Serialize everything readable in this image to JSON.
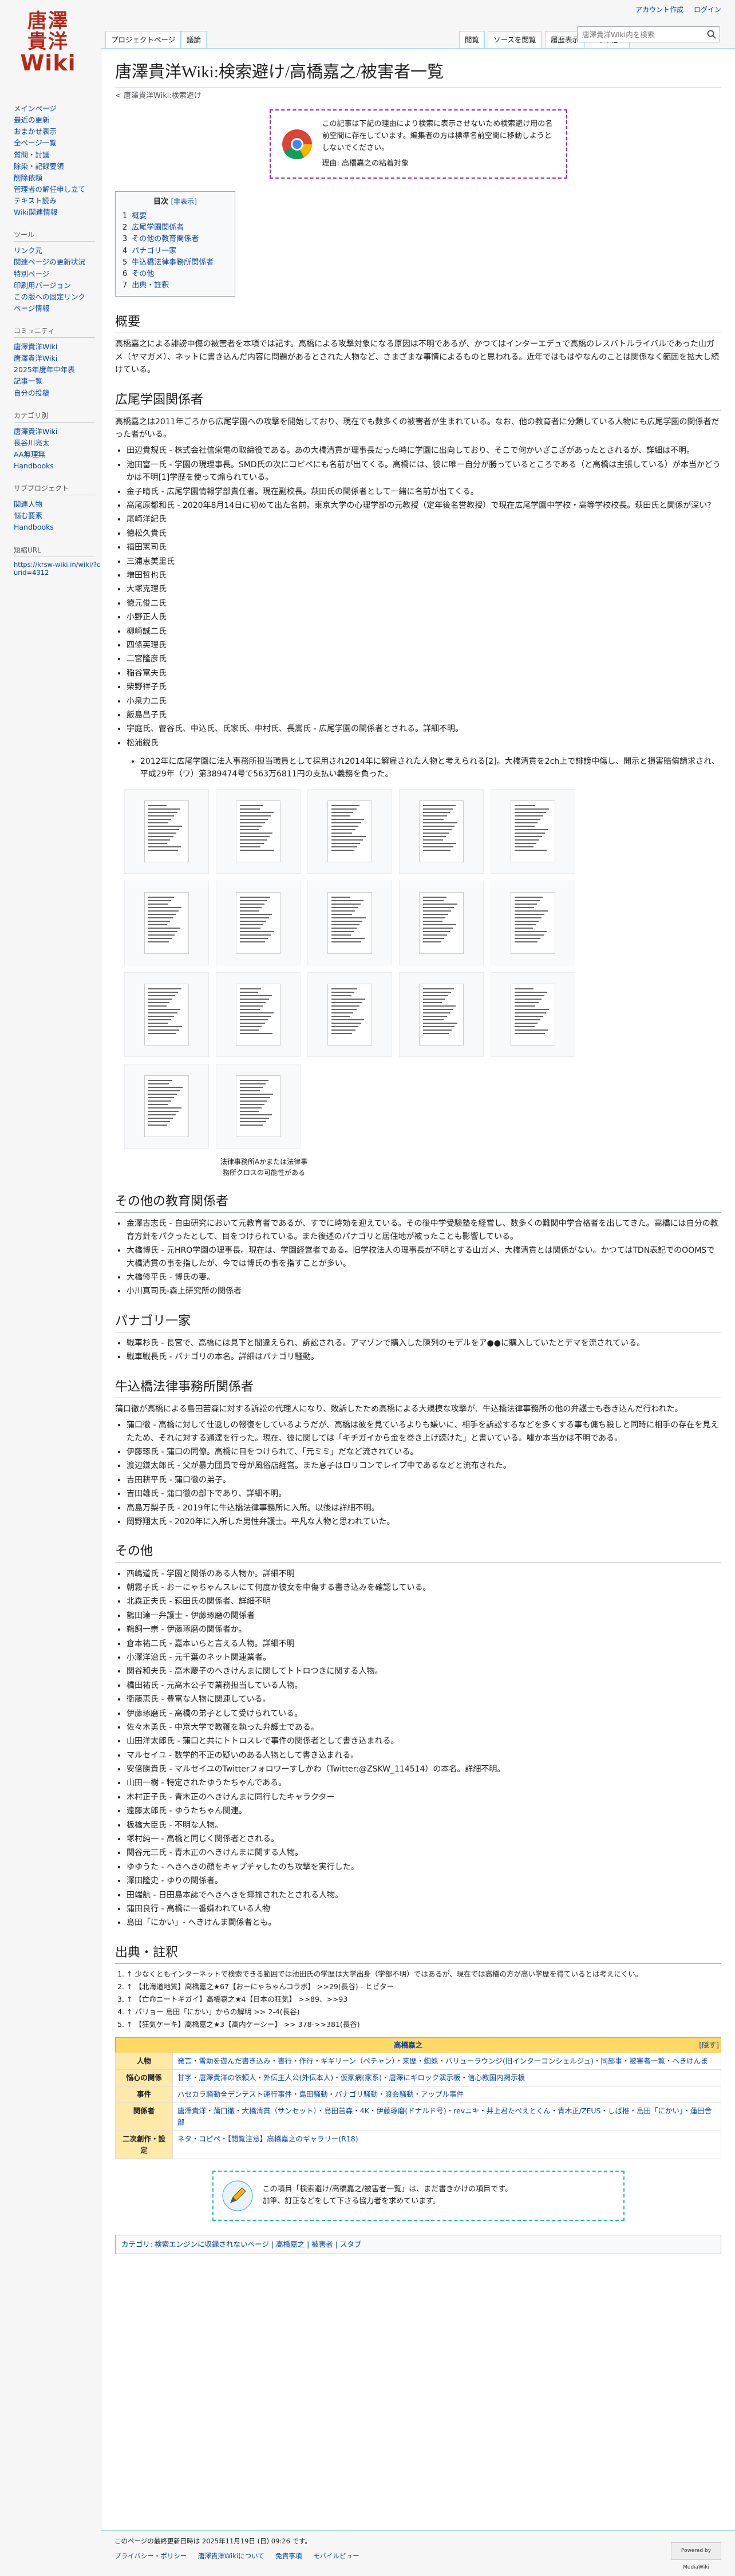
{
  "logo": {
    "line1": "唐澤",
    "line2": "貴洋",
    "line3": "Wiki"
  },
  "personal": {
    "create": "アカウント作成",
    "login": "ログイン"
  },
  "tabs": {
    "project": "プロジェクトページ",
    "talk": "議論",
    "read": "閲覧",
    "edit_source": "ソースを閲覧",
    "history": "履歴表示",
    "more": "その他"
  },
  "search": {
    "placeholder": "唐澤貴洋Wiki内を検索"
  },
  "sidebar": {
    "nav": [
      "メインページ",
      "最近の更新",
      "おまかせ表示",
      "全ページ一覧",
      "質問・討議",
      "除染・記録要領",
      "削除依頼",
      "管理者の解任申し立て",
      "テキスト読み",
      "Wiki関連情報"
    ],
    "tools_h": "ツール",
    "tools": [
      "リンク元",
      "関連ページの更新状況",
      "特別ページ",
      "印刷用バージョン",
      "この版への固定リンク",
      "ページ情報"
    ],
    "links_h": "コミュニティ",
    "links": [
      "唐澤貴洋Wiki",
      "唐澤貴洋Wiki",
      "2025年度年中年表",
      "記事一覧",
      "自分の投稿"
    ],
    "cat_h": "カテゴリ別",
    "cats": [
      "唐澤貴洋Wiki",
      "長谷川亮太",
      "AA無理無",
      "Handbooks"
    ],
    "sub_h": "サブプロジェクト",
    "subs": [
      "関連人物",
      "悩む要素",
      "Handbooks"
    ],
    "short_h": "短縮URL",
    "short": "https://krsw-wiki.in/wiki/?curid=4312"
  },
  "page": {
    "title": "唐澤貴洋Wiki:検索避け/高橋嘉之/被害者一覧",
    "subtitle": "< 唐澤貴洋Wiki:検索避け",
    "notice_line1": "この記事は下記の理由により検索に表示させないため検索避け用の名前空間に存在しています。編集者の方は標準名前空間に移動しようとしないでください。",
    "notice_reason": "理由: 高橋嘉之の粘着対象"
  },
  "toc": {
    "title": "目次",
    "hide": "[非表示]",
    "items": [
      {
        "n": "1",
        "t": "概要"
      },
      {
        "n": "2",
        "t": "広尾学園関係者"
      },
      {
        "n": "3",
        "t": "その他の教育関係者"
      },
      {
        "n": "4",
        "t": "パナゴリ一家"
      },
      {
        "n": "5",
        "t": "牛込橋法律事務所関係者"
      },
      {
        "n": "6",
        "t": "その他"
      },
      {
        "n": "7",
        "t": "出典・註釈"
      }
    ]
  },
  "sections": {
    "s1": "概要",
    "s1p": "高橋嘉之による誹謗中傷の被害者を本項では記す。高橋による攻撃対象になる原因は不明であるが、かつてはインターエデュで高橋のレスバトルライバルであった山ガメ（ヤマガメ）、ネットに書き込んだ内容に問題があるとされた人物など、さまざまな事情によるものと思われる。近年ではもはやなんのことは関係なく範囲を拡大し続けている。",
    "s2": "広尾学園関係者",
    "s2p": "高橋嘉之は2011年ごろから広尾学園への攻撃を開始しており、現在でも数多くの被害者が生まれている。なお、他の教育者に分類している人物にも広尾学園の関係者だった者がいる。",
    "s2items": [
      "田辺貴規氏 - 株式会社信栄電の取締役である。あの大橋清貫が理事長だった時に学園に出向しており、そこで何かいざこざがあったとされるが、詳細は不明。",
      "池田富一氏 - 学園の現理事長。SMD氏の次にコピペにも名前が出てくる。高橋には、彼に唯一自分が勝っているところである（と高橋は主張している）が本当かどうかは不明[1]学歴を使って煽られている。",
      "金子晴氏 - 広尾学園情報学部責任者。現在副校長。萩田氏の関係者として一緒に名前が出てくる。",
      "高尾原都和氏 - 2020年8月14日に初めて出た名前。東京大学の心理学部の元教授（定年後名誉教授）で現在広尾学園中学校・高等学校校長。萩田氏と関係が深い?",
      "尾崎洋紀氏",
      "徳松久貴氏",
      "福田憲司氏",
      "三浦恵美里氏",
      "増田哲也氏",
      "大塚克理氏",
      "徳元俊二氏",
      "小野正人氏",
      "柳崎誠二氏",
      "四條英理氏",
      "二宮隆彦氏",
      "稲谷富夫氏",
      "柴野祥子氏",
      "小泉力二氏",
      "飯島昌子氏",
      "宇庭氏、菅谷氏、中込氏、氏家氏、中村氏、長嵩氏 - 広尾学園の関係者とされる。詳細不明。",
      "松浦鋭氏"
    ],
    "s2sub": "2012年に広尾学園に法人事務所担当職員として採用され2014年に解雇された人物と考えられる[2]。大橋清貫を2ch上で誹謗中傷し、開示と損害賠償請求され、平成29年（ワ）第389474号で563万6811円の支払い義務を負った。",
    "gallery_cap": "法律事務所Aかまたは法律事務所クロスの可能性がある",
    "s3": "その他の教育関係者",
    "s3items": [
      "金澤古志氏 - 自由研究において元教育者であるが、すでに時効を迎えている。その後中学受験塾を経営し、数多くの難関中学合格者を出してきた。高橋には自分の教育方針をパクったとして、目をつけられている。また後述のパナゴリと居住地が被ったことも影響している。",
      "大橋博氏 - 元HRO学園の理事長。現在は、学園経営者である。旧学校法人の理事長が不明とする山ガメ、大橋清貫とは関係がない。かつてはTDN表記でのOOMSで大橋清貫の事を指したが、今では博氏の事を指すことが多い。",
      "大橋修平氏 - 博氏の妻。",
      "小川真司氏-森上研究所の関係者"
    ],
    "s4": "パナゴリ一家",
    "s4items": [
      "戦車杉氏 - 長宮で、高橋には見下と間違えられ、訴訟される。アマゾンで購入した陳列のモデルをア●●に購入していたとデマを流されている。",
      "戦車戦長氏 - パナゴリの本名。詳細はパナゴリ騒動。"
    ],
    "s5": "牛込橋法律事務所関係者",
    "s5p": "蒲口徹が高橋による島田苦森に対する訴訟の代理人になり、敗訴したため高橋による大規模な攻撃が、牛込橋法律事務所の他の弁護士も巻き込んだ行われた。",
    "s5items": [
      "蒲口徹 - 高橋に対して仕返しの報復をしているようだが、高橋は彼を見ているよりも嫌いに、相手を訴訟するなどを多くする事も傭ち殺しと同時に相手の存在を見えたため、それに対する通達を行った。現在、彼に関しては「キチガイから金を巻き上げ続けた」と書いている。嘘か本当かは不明である。",
      "伊藤琢氏 - 蒲口の同僚。高橋に目をつけられて、「元ミミ」だなど流されている。",
      "渡辺鎌太郎氏 - 父が暴力団員で母が風俗店経営。また息子はロリコンでレイプ中であるなどと流布された。",
      "吉田耕平氏 - 蒲口徹の弟子。",
      "吉田雄氏 - 蒲口徹の部下であり、詳細不明。",
      "高島万梨子氏 - 2019年に牛込橋法律事務所に入所。以後は詳細不明。",
      "岡野翔太氏 - 2020年に入所した男性弁護士。平凡な人物と思われていた。"
    ],
    "s6": "その他",
    "s6items": [
      "西嶋道氏 - 学園と関係のある人物か。詳細不明",
      "朝霧子氏 - おーにゃちゃんスレにて何度か彼女を中傷する書き込みを確認している。",
      "北森正夫氏 - 萩田氏の関係者、詳細不明",
      "鶴田達一弁護士 - 伊藤琢磨の関係者",
      "鵜飼一崇 - 伊藤琢磨の関係者か。",
      "倉本祐二氏 - 嘉本いらと言える人物。詳細不明",
      "小澤洋治氏 - 元千葉のネット関連業者。",
      "関谷和夫氏 - 高木慶子のへきけんまに関してトトロつきに関する人物。",
      "橋田祐氏 - 元高木公子で業務担当している人物。",
      "衛藤恵氏 - 豊富な人物に関連している。",
      "伊藤琢磨氏 - 高橋の弟子として受けられている。",
      "佐々木勇氏 - 中京大学で教鞭を執った弁護士である。",
      "山田洋太郎氏 - 蒲口と共にトトロスレで事件の関係者として書き込まれる。",
      "マルセイユ - 数学的不正の疑いのある人物として書き込まれる。",
      "安倍勝貴氏 - マルセイユのTwitterフォロワーすしかわ（Twitter:@ZSKW_114514）の本名。詳細不明。",
      "山田一樹 - 特定されたゆうたちゃんである。",
      "木村正子氏 - 青木正のへきけんまに同行したキャラクター",
      "遠藤太郎氏 - ゆうたちゃん関連。",
      "板橋大臣氏 - 不明な人物。",
      "塚村純一 - 高橋と同じく関係者とされる。",
      "関谷元三氏 - 青木正のへきけんまに関する人物。",
      "ゆゆうた - ヘきへきの顔をキャプチャしたのち攻撃を実行した。",
      "澤田隆史 - ゆりの関係者。",
      "田端航 - 日田島本誌でヘきへきを揶揄されたとされる人物。",
      "蒲田良行 - 高橋に一番嫌われている人物",
      "島田「にかい」- へきけんま関係者とも。"
    ],
    "s7": "出典・註釈",
    "refs": [
      "↑ 少なくともインターネットで検索できる範囲では池田氏の学歴は大学出身（学部不明）ではあるが、現在では高橋の方が高い学歴を得ているとは考えにくい。",
      "↑ 【北海道地質】高橋嘉之★67【おーにゃちゃんコラボ】 >>29(長谷) - ヒビター",
      "↑ 【亡命ニートギガイ】高橋嘉之★4【日本の狂気】 >>89、>>93",
      "↑ パリョー 島田「にかい」からの解明 >> 2-4(長谷)",
      "↑ 【狂気ケーキ】高橋嘉之★3【高内ケーシー】 >> 378->>381(長谷)"
    ],
    "navbox_title": "高橋嘉之",
    "navbox_toggle": "[隠す]",
    "nav": [
      {
        "h": "人物",
        "v": "発言・雪助を遊んだ書き込み・書行・作行・ギギリーン（ペチャン）・来歴・蜘蛛・バリューラウンジ(旧インターコンシェルジュ)・同部事・被害者一覧・へきけんま"
      },
      {
        "h": "悩心の関係",
        "v": "甘字・唐澤貴洋の依頼人・外伝主人公(外伝本人)・仮家病(家系)・唐澤にギロック演示板・信心教国内掲示板"
      },
      {
        "h": "事件",
        "v": "ハセカラ騒動全デンテスト運行事件・島田騒動・パナゴリ騒動・渡会騒動・アップル事件"
      },
      {
        "h": "関係者",
        "v": "唐澤貴洋・蒲口徹・大橋清貫（サンセット）・島田苦森・4K・伊藤琢磨(ドナルド号)・revニキ・井上君たぺえとくん・青木正/ZEUS・しば推・島田「にかい」・蓮田舎部"
      },
      {
        "h": "二次創作・設定",
        "v": "ネタ・コピペ・【閲覧注意】高橋嘉之のギャラリー(R18)"
      }
    ],
    "stub1": "この項目「検索避け/高橋嘉之/被害者一覧」は、まだ書きかけの項目です。",
    "stub2": "加筆、訂正などをして下さる協力者を求めています。",
    "catlinks": "カテゴリ: 検索エンジンに収録されないページ | 高橋嘉之 | 被害者 | スタブ"
  },
  "footer": {
    "last": "このページの最終更新日時は 2025年11月19日 (日) 09:26 です。",
    "links": [
      "プライバシー・ポリシー",
      "唐澤貴洋Wikiについて",
      "免責事項",
      "モバイルビュー"
    ],
    "badge": "Powered by MediaWiki"
  }
}
